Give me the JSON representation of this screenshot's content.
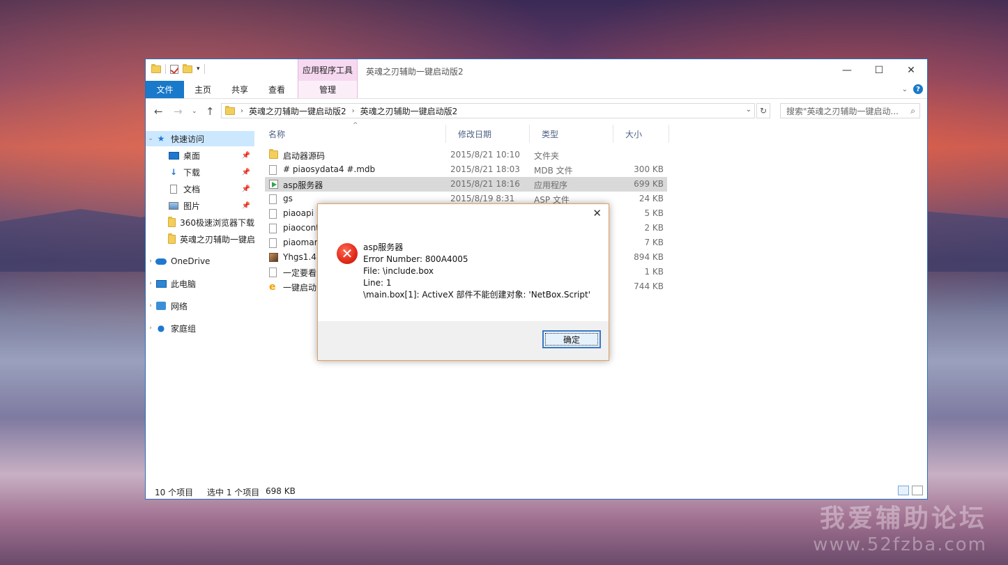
{
  "window": {
    "title": "英魂之刃辅助一键启动版2",
    "context_tab": "应用程序工具",
    "controls": [
      "—",
      "☐",
      "✕"
    ]
  },
  "ribbon": {
    "tabs": [
      "文件",
      "主页",
      "共享",
      "查看",
      "管理"
    ],
    "help": "?"
  },
  "address": {
    "crumbs": [
      "英魂之刃辅助一键启动版2",
      "英魂之刃辅助一键启动版2"
    ],
    "search_placeholder": "搜索\"英魂之刃辅助一键启动..."
  },
  "nav": {
    "quick_access": "快速访问",
    "pinned": [
      {
        "label": "桌面",
        "icon": "desktop-icon"
      },
      {
        "label": "下载",
        "icon": "download-icon"
      },
      {
        "label": "文档",
        "icon": "documents-icon"
      },
      {
        "label": "图片",
        "icon": "pictures-icon"
      },
      {
        "label": "360极速浏览器下载",
        "icon": "folder-icon"
      },
      {
        "label": "英魂之刃辅助一键启",
        "icon": "folder-icon"
      }
    ],
    "onedrive": "OneDrive",
    "this_pc": "此电脑",
    "network": "网络",
    "homegroup": "家庭组"
  },
  "columns": {
    "name": "名称",
    "date": "修改日期",
    "type": "类型",
    "size": "大小"
  },
  "files": [
    {
      "name": "启动器源码",
      "date": "2015/8/21 10:10",
      "type": "文件夹",
      "size": "",
      "icon": "folder-icon"
    },
    {
      "name": "# piaosydata4  #.mdb",
      "date": "2015/8/21 18:03",
      "type": "MDB 文件",
      "size": "300 KB",
      "icon": "file-icon"
    },
    {
      "name": "asp服务器",
      "date": "2015/8/21 18:16",
      "type": "应用程序",
      "size": "699 KB",
      "icon": "exe-icon"
    },
    {
      "name": "gs",
      "date": "2015/8/19 8:31",
      "type": "ASP 文件",
      "size": "24 KB",
      "icon": "file-icon"
    },
    {
      "name": "piaoapi",
      "date": "",
      "type": "",
      "size": "5 KB",
      "icon": "file-icon"
    },
    {
      "name": "piaocont",
      "date": "",
      "type": "",
      "size": "2 KB",
      "icon": "file-icon"
    },
    {
      "name": "piaomar",
      "date": "",
      "type": "",
      "size": "7 KB",
      "icon": "file-icon"
    },
    {
      "name": "Yhgs1.4.",
      "date": "",
      "type": "",
      "size": "894 KB",
      "icon": "image-icon"
    },
    {
      "name": "一定要看",
      "date": "",
      "type": "",
      "size": "1 KB",
      "icon": "file-icon"
    },
    {
      "name": "一键启动",
      "date": "",
      "type": "",
      "size": "744 KB",
      "icon": "ie-icon"
    }
  ],
  "status": {
    "count": "10 个项目",
    "selected": "选中 1 个项目",
    "selected_size": "698 KB"
  },
  "dialog": {
    "title": "asp服务器",
    "lines": [
      "Error Number: 800A4005",
      "File: \\include.box",
      "Line: 1",
      "\\main.box[1]: ActiveX 部件不能创建对象: 'NetBox.Script'"
    ],
    "ok": "确定",
    "close": "✕"
  },
  "watermark": {
    "line1": "我爱辅助论坛",
    "line2": "www.52fzba.com"
  }
}
